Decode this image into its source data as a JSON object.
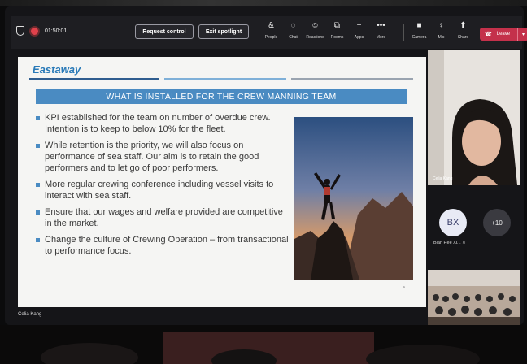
{
  "toolbar": {
    "timer": "01:50:01",
    "request_control": "Request control",
    "exit_spotlight": "Exit spotlight",
    "items": [
      {
        "label": "People",
        "icon": "people-icon",
        "glyph": "&"
      },
      {
        "label": "Chat",
        "icon": "chat-icon",
        "glyph": "◌"
      },
      {
        "label": "Reactions",
        "icon": "reactions-icon",
        "glyph": "☺"
      },
      {
        "label": "Rooms",
        "icon": "rooms-icon",
        "glyph": "⧉"
      },
      {
        "label": "Apps",
        "icon": "apps-icon",
        "glyph": "+"
      },
      {
        "label": "More",
        "icon": "more-icon",
        "glyph": "•••"
      }
    ],
    "right_items": [
      {
        "label": "Camera",
        "icon": "camera-icon",
        "glyph": "■"
      },
      {
        "label": "Mic",
        "icon": "mic-icon",
        "glyph": "♀"
      },
      {
        "label": "Share",
        "icon": "share-icon",
        "glyph": "⬆"
      }
    ],
    "leave": "Leave",
    "leave_color": "#c4314b"
  },
  "slide": {
    "logo": "Eastaway",
    "title": "WHAT IS INSTALLED FOR THE CREW MANNING TEAM",
    "bullets": [
      "KPI established for the team on number of overdue crew. Intention is to keep to below 10% for the fleet.",
      "While retention is the priority, we will also focus on performance of sea staff. Our aim is to retain the good performers and to let go of poor performers.",
      "More regular crewing conference including vessel visits to interact with sea staff.",
      "Ensure that our wages and welfare provided are competitive in the market.",
      "Change the culture of Crewing Operation – from transactional to performance focus."
    ],
    "accent_color": "#4a8bc2"
  },
  "presenter": "Celia Kang",
  "participants": {
    "video_tile_name": "Celia Kang",
    "avatar_initials": "BX",
    "avatar_name": "Bian Hee Xi...",
    "overflow_count": "+10"
  }
}
